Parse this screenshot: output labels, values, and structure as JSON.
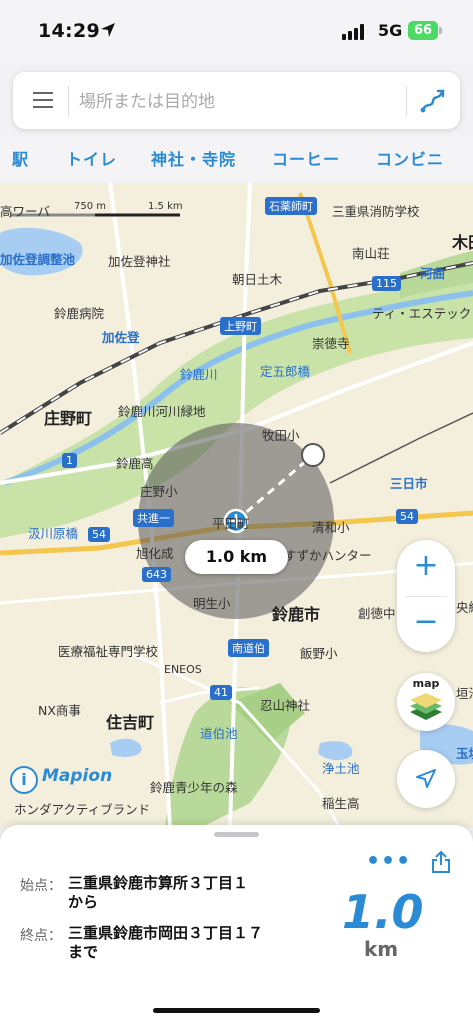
{
  "status": {
    "time": "14:29",
    "network": "5G",
    "battery": "66"
  },
  "search": {
    "placeholder": "場所または目的地"
  },
  "categories": [
    "駅",
    "トイレ",
    "神社・寺院",
    "コーヒー",
    "コンビニ"
  ],
  "map": {
    "scale": {
      "left": "750 m",
      "right": "1.5 km"
    },
    "labels": {
      "l1": "石薬師町",
      "l2": "三重県消防学校",
      "l3": "南山荘",
      "l4": "木田",
      "l5": "加佐登調整池",
      "l6": "加佐登神社",
      "l7": "朝日土木",
      "l8": "河曲",
      "l9": "ティ・エステック",
      "l10": "鈴鹿病院",
      "l11": "加佐登",
      "l12": "上野町",
      "l13": "崇徳寺",
      "l14": "鈴鹿川",
      "l15": "定五郎橋",
      "l16": "庄野町",
      "l17": "鈴鹿川河川緑地",
      "l18": "牧田小",
      "l19": "鈴鹿高",
      "l20": "三日市",
      "l21": "庄野小",
      "l22": "共進一",
      "l23": "汲川原橋",
      "l24": "清和小",
      "l25": "旭化成",
      "l26": "すずかハンター",
      "l27": "明生小",
      "l28": "鈴鹿市",
      "l29": "創徳中",
      "l30": "医療福祉専門学校",
      "l31": "南道伯",
      "l32": "飯野小",
      "l33": "ENEOS",
      "l34": "NX商事",
      "l35": "忍山神社",
      "l36": "住吉町",
      "l37": "道伯池",
      "l38": "浄土池",
      "l39": "鈴鹿青少年の森",
      "l40": "ホンダアクティブランド",
      "l41": "稲生高",
      "l42": "平田町",
      "l43": "高ワーバ",
      "l44": "央緑",
      "l45": "垣池",
      "l46": "玉垣"
    },
    "routes": {
      "r115": "115",
      "r1": "1",
      "r54a": "54",
      "r54b": "54",
      "r41": "41",
      "r643": "643"
    },
    "radius_label": "1.0 km",
    "layer_label": "map",
    "logo": "Mapion"
  },
  "sheet": {
    "start_label": "始点：",
    "start_value_line1": "三重県鈴鹿市算所３丁目１",
    "start_value_line2": "から",
    "end_label": "終点：",
    "end_value_line1": "三重県鈴鹿市岡田３丁目１７",
    "end_value_line2": "まで",
    "distance": "1.0",
    "unit": "km"
  }
}
